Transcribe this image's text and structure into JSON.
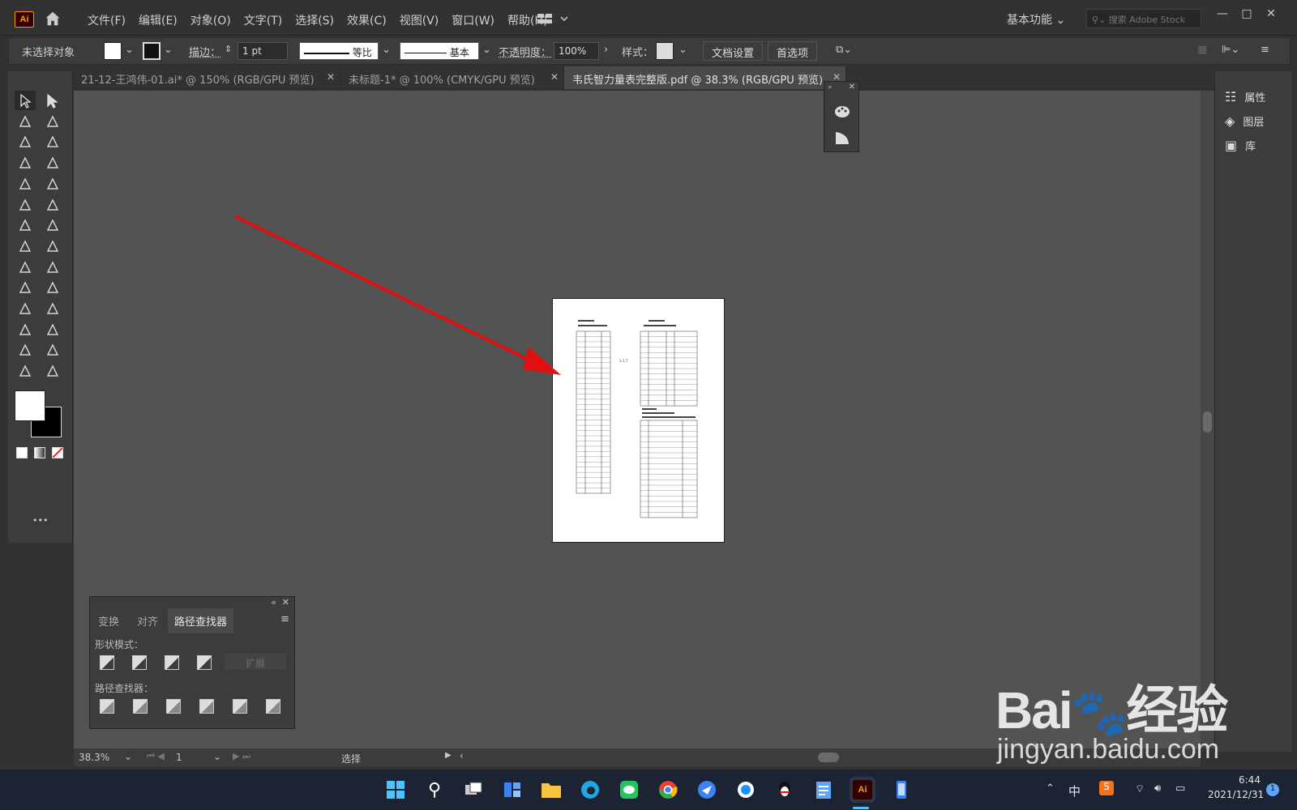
{
  "app": {
    "logo": "Ai",
    "menus": [
      "文件(F)",
      "编辑(E)",
      "对象(O)",
      "文字(T)",
      "选择(S)",
      "效果(C)",
      "视图(V)",
      "窗口(W)",
      "帮助(H)"
    ],
    "workspace": "基本功能",
    "stock_placeholder": "搜索 Adobe Stock"
  },
  "control": {
    "no_selection": "未选择对象",
    "stroke_label": "描边：",
    "stroke_value": "1 pt",
    "stroke_profile": "等比",
    "brush": "基本",
    "opacity_label": "不透明度：",
    "opacity_value": "100%",
    "style_label": "样式：",
    "doc_setup": "文档设置",
    "prefs": "首选项"
  },
  "tabs": [
    {
      "label": "21-12-王鸿伟-01.ai* @ 150% (RGB/GPU 预览)"
    },
    {
      "label": "未标题-1* @ 100% (CMYK/GPU 预览)"
    },
    {
      "label": "韦氏智力量表完整版.pdf @ 38.3% (RGB/GPU 预览)"
    }
  ],
  "right_panel": {
    "items": [
      "属性",
      "图层",
      "库"
    ]
  },
  "pathfinder": {
    "tabs": [
      "变换",
      "对齐",
      "路径查找器"
    ],
    "shape_modes": "形状模式：",
    "expand": "扩展",
    "pathfinders": "路径查找器："
  },
  "status": {
    "zoom": "38.3%",
    "page": "1",
    "mode": "选择"
  },
  "taskbar": {
    "ime": "中",
    "time": "6:44",
    "date": "2021/12/31",
    "badge": "1"
  },
  "watermark": {
    "main": "Bai",
    "main2": "经验",
    "url": "jingyan.baidu.com"
  },
  "doc": {
    "mark": "1-1.7"
  },
  "colors": {
    "accent": "#ff9a00",
    "arrow": "#e01010"
  }
}
